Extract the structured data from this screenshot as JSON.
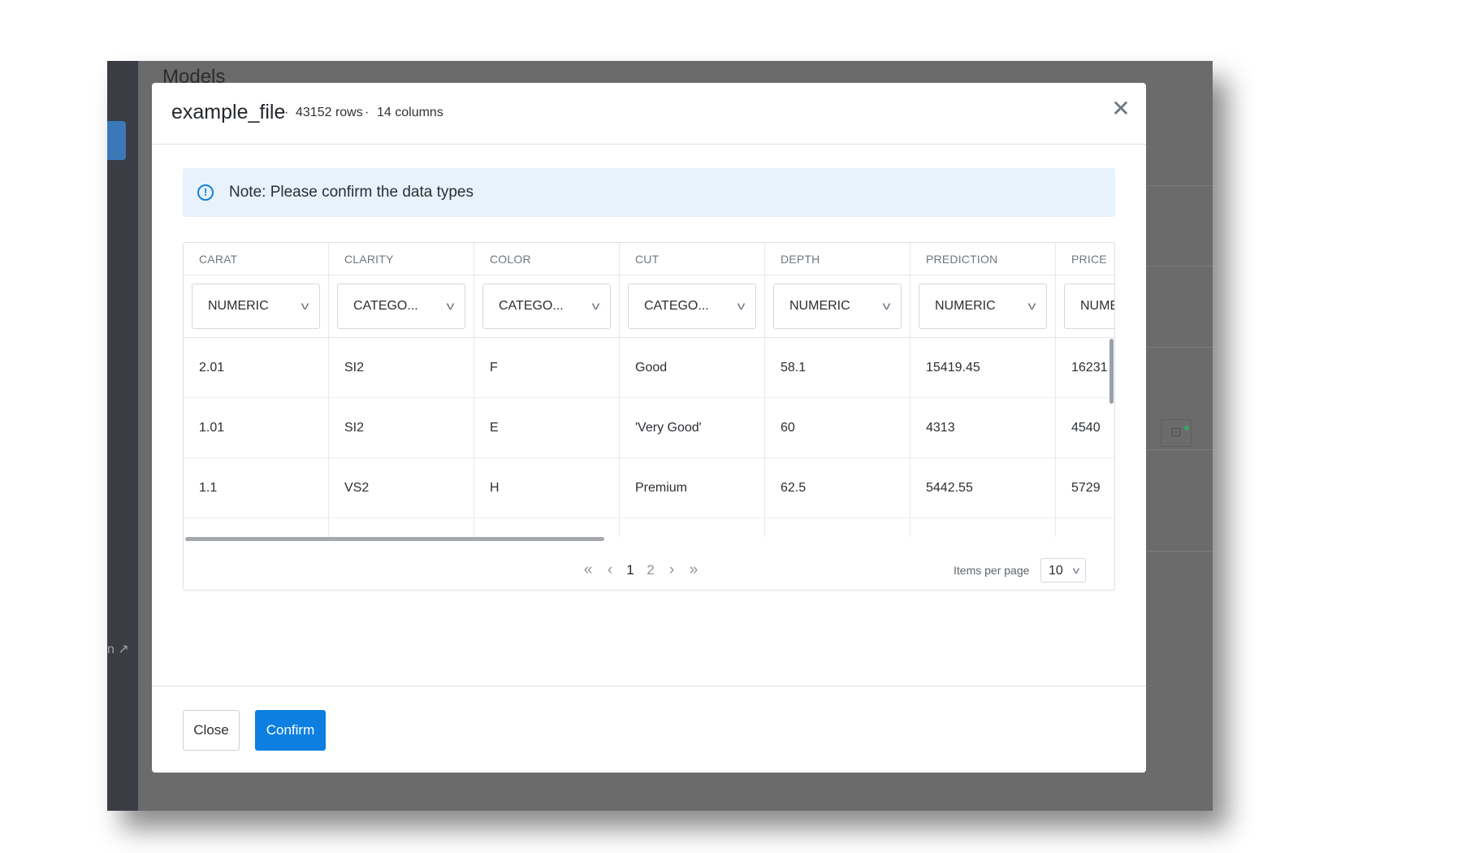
{
  "background": {
    "page_title": "Models",
    "sidebar_link_fragment": "n"
  },
  "modal": {
    "title": "example_file",
    "rows_label": "43152 rows",
    "columns_label": "14 columns",
    "separator": "·",
    "close_glyph": "✕",
    "note": {
      "icon": "info-icon",
      "text": "Note: Please confirm the data types"
    },
    "table": {
      "columns": [
        {
          "name": "CARAT",
          "type": "NUMERIC"
        },
        {
          "name": "CLARITY",
          "type": "CATEGO..."
        },
        {
          "name": "COLOR",
          "type": "CATEGO..."
        },
        {
          "name": "CUT",
          "type": "CATEGO..."
        },
        {
          "name": "DEPTH",
          "type": "NUMERIC"
        },
        {
          "name": "PREDICTION",
          "type": "NUMERIC"
        },
        {
          "name": "PRICE",
          "type": "NUMERIC"
        }
      ],
      "rows": [
        [
          "2.01",
          "SI2",
          "F",
          "Good",
          "58.1",
          "15419.45",
          "16231"
        ],
        [
          "1.01",
          "SI2",
          "E",
          "'Very Good'",
          "60",
          "4313",
          "4540"
        ],
        [
          "1.1",
          "VS2",
          "H",
          "Premium",
          "62.5",
          "5442.55",
          "5729"
        ]
      ]
    },
    "pagination": {
      "first_glyph": "«",
      "prev_glyph": "‹",
      "pages": [
        "1",
        "2"
      ],
      "current_page": "1",
      "next_glyph": "›",
      "last_glyph": "»",
      "items_per_page_label": "Items per page",
      "items_per_page_value": "10"
    },
    "footer": {
      "close_label": "Close",
      "confirm_label": "Confirm"
    }
  },
  "colors": {
    "accent": "#0d7fe0",
    "note_background": "#e7f2fc",
    "overlay": "#6b6b6b"
  }
}
